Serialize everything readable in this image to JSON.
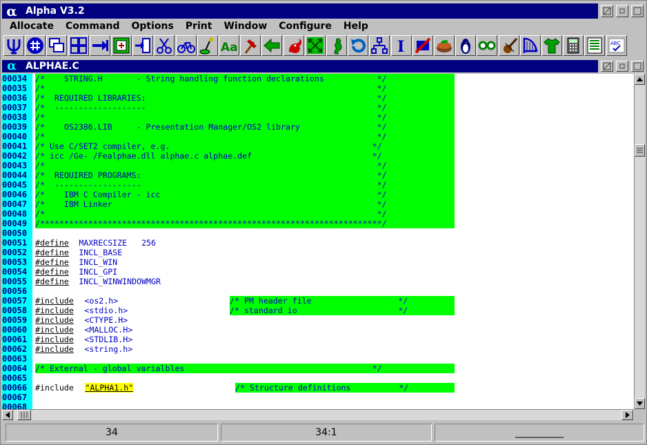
{
  "app": {
    "title": "Alpha V3.2",
    "logo_glyph": "α"
  },
  "window_buttons": {
    "restore": "▢",
    "minimize": "▫",
    "maximize": "□"
  },
  "menu": [
    "Allocate",
    "Command",
    "Options",
    "Print",
    "Window",
    "Configure",
    "Help"
  ],
  "toolbar": [
    {
      "name": "fork-icon"
    },
    {
      "name": "hash-icon"
    },
    {
      "name": "windows-icon"
    },
    {
      "name": "tile-icon"
    },
    {
      "name": "arrow-right-icon"
    },
    {
      "name": "frame-plus-icon"
    },
    {
      "name": "insert-icon"
    },
    {
      "name": "scissors-icon"
    },
    {
      "name": "bicycle-icon"
    },
    {
      "name": "vacuum-icon"
    },
    {
      "name": "font-icon"
    },
    {
      "name": "hammer-icon"
    },
    {
      "name": "arrow-left-icon"
    },
    {
      "name": "squirrel-icon"
    },
    {
      "name": "expand-icon"
    },
    {
      "name": "seahorse-icon"
    },
    {
      "name": "undo-icon"
    },
    {
      "name": "tree-icon"
    },
    {
      "name": "cursor-icon"
    },
    {
      "name": "no-entry-icon"
    },
    {
      "name": "pie-icon"
    },
    {
      "name": "penguin-icon"
    },
    {
      "name": "glasses-icon"
    },
    {
      "name": "violin-icon"
    },
    {
      "name": "harp-icon"
    },
    {
      "name": "shirt-icon"
    },
    {
      "name": "calculator-icon"
    },
    {
      "name": "list-icon"
    },
    {
      "name": "spellcheck-icon"
    }
  ],
  "toolbar_text": {
    "font_label": "Aa",
    "cursor_label": "I",
    "spell_label": "ABC"
  },
  "document": {
    "title": "ALPHAE.C",
    "logo_glyph": "α"
  },
  "colors": {
    "comment_bg": "#00ff00",
    "comment_fg": "#0000c0",
    "highlight_bg": "#ffff00",
    "gutter_bg": "#00ffff",
    "titlebar": "#000080"
  },
  "lines": [
    {
      "num": "00034",
      "segs": [
        {
          "t": "/*    STRING.H       - String handling function declarations           */",
          "c": "cm"
        }
      ]
    },
    {
      "num": "00035",
      "segs": [
        {
          "t": "/*                                                                     */",
          "c": "cm"
        }
      ]
    },
    {
      "num": "00036",
      "segs": [
        {
          "t": "/*  REQUIRED LIBRARIES:                                                */",
          "c": "cm"
        }
      ]
    },
    {
      "num": "00037",
      "segs": [
        {
          "t": "/*  -------------------                                                */",
          "c": "cm"
        }
      ]
    },
    {
      "num": "00038",
      "segs": [
        {
          "t": "/*                                                                     */",
          "c": "cm"
        }
      ]
    },
    {
      "num": "00039",
      "segs": [
        {
          "t": "/*    OS2386.LIB     - Presentation Manager/OS2 library                */",
          "c": "cm"
        }
      ]
    },
    {
      "num": "00040",
      "segs": [
        {
          "t": "/*                                                                     */",
          "c": "cm"
        }
      ]
    },
    {
      "num": "00041",
      "segs": [
        {
          "t": "/* Use C/SET2 compiler, e.g.                                          */",
          "c": "cm"
        }
      ]
    },
    {
      "num": "00042",
      "segs": [
        {
          "t": "/* icc /Ge- /Fealphae.dll alphae.c alphae.def                         */",
          "c": "cm"
        }
      ]
    },
    {
      "num": "00043",
      "segs": [
        {
          "t": "/*                                                                     */",
          "c": "cm"
        }
      ]
    },
    {
      "num": "00044",
      "segs": [
        {
          "t": "/*  REQUIRED PROGRAMS:                                                 */",
          "c": "cm"
        }
      ]
    },
    {
      "num": "00045",
      "segs": [
        {
          "t": "/*  ------------------                                                 */",
          "c": "cm"
        }
      ]
    },
    {
      "num": "00046",
      "segs": [
        {
          "t": "/*    IBM C Compiler - icc                                             */",
          "c": "cm"
        }
      ]
    },
    {
      "num": "00047",
      "segs": [
        {
          "t": "/*    IBM Linker                                                       */",
          "c": "cm"
        }
      ]
    },
    {
      "num": "00048",
      "segs": [
        {
          "t": "/*                                                                     */",
          "c": "cm"
        }
      ]
    },
    {
      "num": "00049",
      "segs": [
        {
          "t": "/***********************************************************************/",
          "c": "cm"
        }
      ]
    },
    {
      "num": "00050",
      "segs": []
    },
    {
      "num": "00051",
      "segs": [
        {
          "t": "#define",
          "c": "kw"
        },
        {
          "t": " MAXRECSIZE   256",
          "c": "nm"
        }
      ]
    },
    {
      "num": "00052",
      "segs": [
        {
          "t": "#define",
          "c": "kw"
        },
        {
          "t": " INCL_BASE",
          "c": "nm"
        }
      ]
    },
    {
      "num": "00053",
      "segs": [
        {
          "t": "#define",
          "c": "kw"
        },
        {
          "t": " INCL_WIN",
          "c": "nm"
        }
      ]
    },
    {
      "num": "00054",
      "segs": [
        {
          "t": "#define",
          "c": "kw"
        },
        {
          "t": " INCL_GPI",
          "c": "nm"
        }
      ]
    },
    {
      "num": "00055",
      "segs": [
        {
          "t": "#define",
          "c": "kw"
        },
        {
          "t": " INCL_WINWINDOWMGR",
          "c": "nm"
        }
      ]
    },
    {
      "num": "00056",
      "segs": []
    },
    {
      "num": "00057",
      "segs": [
        {
          "t": "#include",
          "c": "kw"
        },
        {
          "t": " <os2.h>",
          "c": "nm"
        },
        {
          "t": "/* PM header file                  */",
          "c": "cm2"
        }
      ]
    },
    {
      "num": "00058",
      "segs": [
        {
          "t": "#include",
          "c": "kw"
        },
        {
          "t": " <stdio.h>",
          "c": "nm"
        },
        {
          "t": "/* standard io                     */",
          "c": "cm2"
        }
      ]
    },
    {
      "num": "00059",
      "segs": [
        {
          "t": "#include",
          "c": "kw"
        },
        {
          "t": " <CTYPE.H>",
          "c": "nm"
        }
      ]
    },
    {
      "num": "00060",
      "segs": [
        {
          "t": "#include",
          "c": "kw"
        },
        {
          "t": " <MALLOC.H>",
          "c": "nm"
        }
      ]
    },
    {
      "num": "00061",
      "segs": [
        {
          "t": "#include",
          "c": "kw"
        },
        {
          "t": " <STDLIB.H>",
          "c": "nm"
        }
      ]
    },
    {
      "num": "00062",
      "segs": [
        {
          "t": "#include",
          "c": "kw"
        },
        {
          "t": " <string.h>",
          "c": "nm"
        }
      ]
    },
    {
      "num": "00063",
      "segs": []
    },
    {
      "num": "00064",
      "segs": [
        {
          "t": "/* External - global varialbles                                       */",
          "c": "cm"
        }
      ]
    },
    {
      "num": "00065",
      "segs": []
    },
    {
      "num": "00066",
      "segs": [
        {
          "t": "#include ",
          "c": "plain"
        },
        {
          "t": "\"ALPHA1.h\"",
          "c": "hl"
        },
        {
          "t": "/* Structure definitions          */",
          "c": "cm3"
        }
      ]
    },
    {
      "num": "00067",
      "segs": []
    },
    {
      "num": "00068",
      "segs": []
    }
  ],
  "status": {
    "left": "34",
    "middle": "34:1",
    "right": "__________"
  }
}
